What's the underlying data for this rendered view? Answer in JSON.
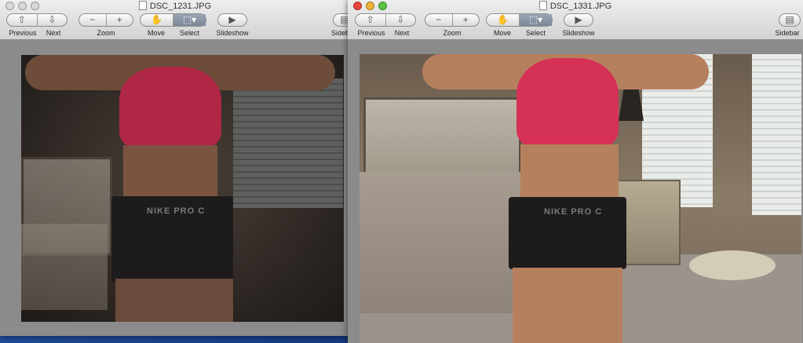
{
  "windows": [
    {
      "title": "DSC_1231.JPG",
      "toolbar": {
        "previous_label": "Previous",
        "next_label": "Next",
        "zoom_label": "Zoom",
        "move_label": "Move",
        "select_label": "Select",
        "slideshow_label": "Slideshow",
        "sidebar_label": "Sideb",
        "zoom_out_glyph": "−",
        "zoom_in_glyph": "+"
      },
      "active": false
    },
    {
      "title": "DSC_1331.JPG",
      "toolbar": {
        "previous_label": "Previous",
        "next_label": "Next",
        "zoom_label": "Zoom",
        "move_label": "Move",
        "select_label": "Select",
        "slideshow_label": "Slideshow",
        "sidebar_label": "Sidebar",
        "zoom_out_glyph": "−",
        "zoom_in_glyph": "+"
      },
      "active": true
    }
  ],
  "photo_text": {
    "shorts_brand": "NIKE PRO C"
  },
  "colors": {
    "sports_bra": "#d63157",
    "desktop": "#1b3f7a",
    "window_bg": "#8b8b8b",
    "close_light": "#e8463e",
    "minimize_light": "#f1b53a",
    "zoom_light": "#5fc343"
  },
  "icons": {
    "previous": "arrow-up-icon",
    "next": "arrow-down-icon",
    "move": "hand-icon",
    "select": "marquee-icon",
    "slideshow": "play-icon",
    "sidebar": "sidebar-icon"
  }
}
